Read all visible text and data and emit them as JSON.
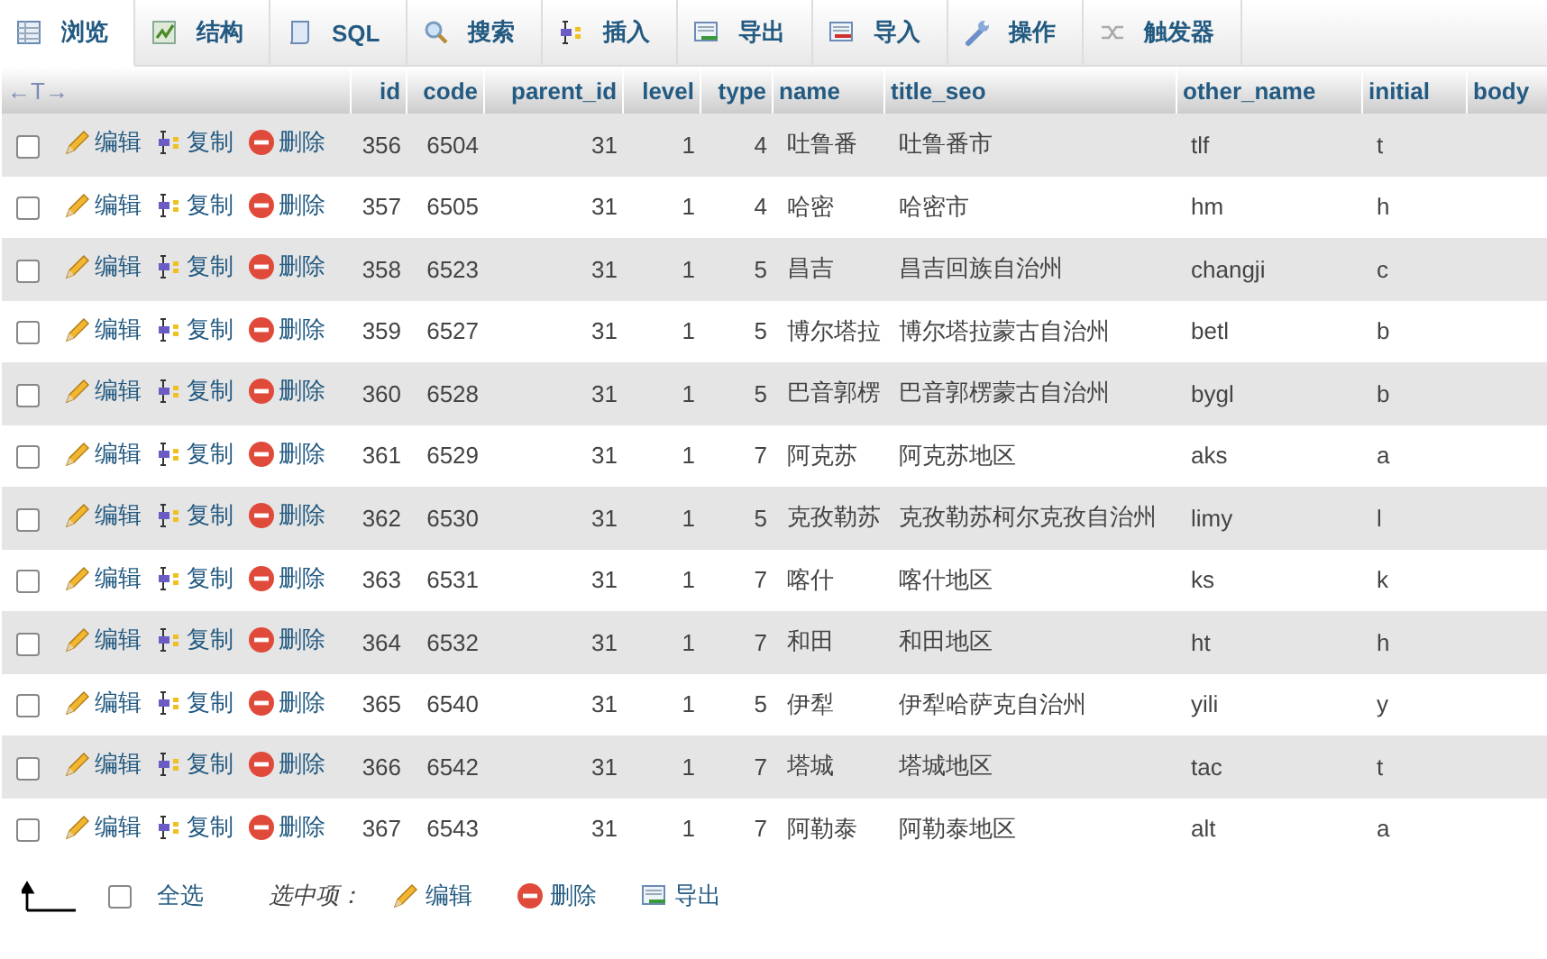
{
  "tabs": [
    {
      "label": "浏览",
      "selected": true
    },
    {
      "label": "结构",
      "selected": false
    },
    {
      "label": "SQL",
      "selected": false
    },
    {
      "label": "搜索",
      "selected": false
    },
    {
      "label": "插入",
      "selected": false
    },
    {
      "label": "导出",
      "selected": false
    },
    {
      "label": "导入",
      "selected": false
    },
    {
      "label": "操作",
      "selected": false
    },
    {
      "label": "触发器",
      "selected": false
    }
  ],
  "table": {
    "corner": "←T→",
    "columns": [
      "id",
      "code",
      "parent_id",
      "level",
      "type",
      "name",
      "title_seo",
      "other_name",
      "initial",
      "body"
    ],
    "rows": [
      {
        "checked": false,
        "actions": [
          "编辑",
          "复制",
          "删除"
        ],
        "cells": [
          "356",
          "6504",
          "31",
          "1",
          "4",
          "吐鲁番",
          "吐鲁番市",
          "tlf",
          "t",
          ""
        ]
      },
      {
        "checked": false,
        "actions": [
          "编辑",
          "复制",
          "删除"
        ],
        "cells": [
          "357",
          "6505",
          "31",
          "1",
          "4",
          "哈密",
          "哈密市",
          "hm",
          "h",
          ""
        ]
      },
      {
        "checked": false,
        "actions": [
          "编辑",
          "复制",
          "删除"
        ],
        "cells": [
          "358",
          "6523",
          "31",
          "1",
          "5",
          "昌吉",
          "昌吉回族自治州",
          "changji",
          "c",
          ""
        ]
      },
      {
        "checked": false,
        "actions": [
          "编辑",
          "复制",
          "删除"
        ],
        "cells": [
          "359",
          "6527",
          "31",
          "1",
          "5",
          "博尔塔拉",
          "博尔塔拉蒙古自治州",
          "betl",
          "b",
          ""
        ]
      },
      {
        "checked": false,
        "actions": [
          "编辑",
          "复制",
          "删除"
        ],
        "cells": [
          "360",
          "6528",
          "31",
          "1",
          "5",
          "巴音郭楞",
          "巴音郭楞蒙古自治州",
          "bygl",
          "b",
          ""
        ]
      },
      {
        "checked": false,
        "actions": [
          "编辑",
          "复制",
          "删除"
        ],
        "cells": [
          "361",
          "6529",
          "31",
          "1",
          "7",
          "阿克苏",
          "阿克苏地区",
          "aks",
          "a",
          ""
        ]
      },
      {
        "checked": false,
        "actions": [
          "编辑",
          "复制",
          "删除"
        ],
        "cells": [
          "362",
          "6530",
          "31",
          "1",
          "5",
          "克孜勒苏",
          "克孜勒苏柯尔克孜自治州",
          "limy",
          "l",
          ""
        ]
      },
      {
        "checked": false,
        "actions": [
          "编辑",
          "复制",
          "删除"
        ],
        "cells": [
          "363",
          "6531",
          "31",
          "1",
          "7",
          "喀什",
          "喀什地区",
          "ks",
          "k",
          ""
        ]
      },
      {
        "checked": false,
        "actions": [
          "编辑",
          "复制",
          "删除"
        ],
        "cells": [
          "364",
          "6532",
          "31",
          "1",
          "7",
          "和田",
          "和田地区",
          "ht",
          "h",
          ""
        ]
      },
      {
        "checked": false,
        "actions": [
          "编辑",
          "复制",
          "删除"
        ],
        "cells": [
          "365",
          "6540",
          "31",
          "1",
          "5",
          "伊犁",
          "伊犁哈萨克自治州",
          "yili",
          "y",
          ""
        ]
      },
      {
        "checked": false,
        "actions": [
          "编辑",
          "复制",
          "删除"
        ],
        "cells": [
          "366",
          "6542",
          "31",
          "1",
          "7",
          "塔城",
          "塔城地区",
          "tac",
          "t",
          ""
        ]
      },
      {
        "checked": false,
        "actions": [
          "编辑",
          "复制",
          "删除"
        ],
        "cells": [
          "367",
          "6543",
          "31",
          "1",
          "7",
          "阿勒泰",
          "阿勒泰地区",
          "alt",
          "a",
          ""
        ]
      }
    ]
  },
  "footer": {
    "select_all": {
      "label": "全选",
      "checked": false
    },
    "with_selected": "选中项：",
    "actions": [
      {
        "kind": "edit",
        "label": "编辑"
      },
      {
        "kind": "delete",
        "label": "删除"
      },
      {
        "kind": "export",
        "label": "导出"
      }
    ]
  }
}
